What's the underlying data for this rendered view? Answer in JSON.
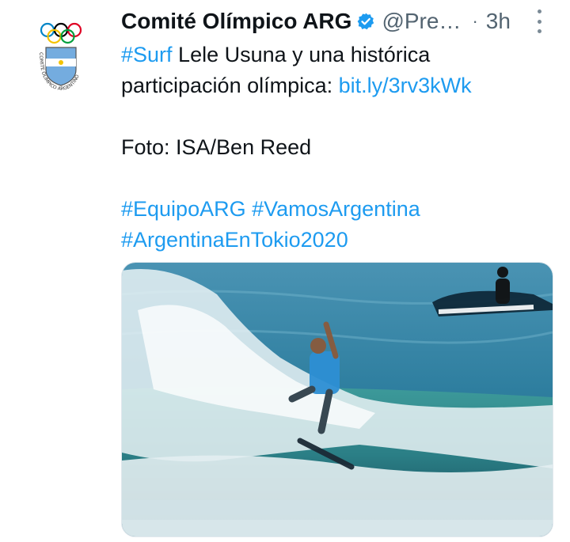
{
  "tweet": {
    "author_name": "Comité Olímpico ARG",
    "handle": "@Pre…",
    "separator": "·",
    "time": "3h",
    "line1_hashtag": "#Surf",
    "line1_text": " Lele Usuna y una histórica",
    "line2_text": "participación olímpica: ",
    "line2_link": "bit.ly/3rv3kWk",
    "line3_text": "Foto: ISA/Ben Reed",
    "hashtags_line1": "#EquipoARG #VamosArgentina",
    "hashtags_line2": "#ArgentinaEnTokio2020"
  },
  "avatar": {
    "seal_text": "COMITE OLIMPICO ARGENTINO"
  },
  "colors": {
    "link": "#1d9bf0",
    "verified": "#1d9bf0",
    "muted": "#536471",
    "sea": "#2f7fa0",
    "flag_blue": "#74acdf"
  },
  "icons": {
    "verified": "verified-badge-icon",
    "more": "more-vertical-icon"
  }
}
